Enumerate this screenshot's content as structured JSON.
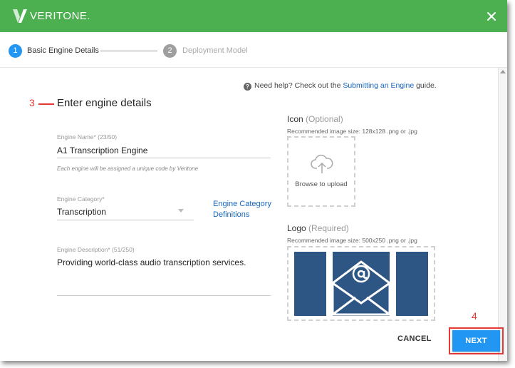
{
  "header": {
    "brand": "VERITONE",
    "brand_dot": ".",
    "close_icon": "close-icon",
    "logo_icon": "veritone-logo-icon",
    "color": "#4caf50"
  },
  "stepper": {
    "steps": [
      {
        "number": "1",
        "label": "Basic Engine Details",
        "active": true
      },
      {
        "number": "2",
        "label": "Deployment Model",
        "active": false
      }
    ],
    "active_color": "#2196f3"
  },
  "help": {
    "icon": "help-icon",
    "prefix": "Need help? Check out the ",
    "link": "Submitting an Engine",
    "suffix": " guide."
  },
  "annotations": {
    "three": "3",
    "four": "4",
    "color": "#e53935"
  },
  "form": {
    "title": "Enter engine details",
    "engine_name": {
      "label": "Engine Name* (23/50)",
      "value": "A1 Transcription Engine",
      "hint": "Each engine will be assigned a unique code by Veritone"
    },
    "engine_category": {
      "label": "Engine Category*",
      "value": "Transcription",
      "definitions_link": "Engine Category Definitions"
    },
    "engine_description": {
      "label": "Engine Description* (51/250)",
      "value": "Providing world-class audio transcription services."
    }
  },
  "icon_upload": {
    "title": "Icon",
    "qualifier": "(Optional)",
    "subtitle": "Recommended image size: 128x128 .png or .jpg",
    "button_text": "Browse to upload",
    "icon": "cloud-upload-icon"
  },
  "logo_upload": {
    "title": "Logo",
    "qualifier": "(Required)",
    "subtitle": "Recommended image size: 500x250 .png or .jpg",
    "image": "envelope-at-logo",
    "image_color": "#2d5684"
  },
  "footer": {
    "cancel": "CANCEL",
    "next": "NEXT"
  }
}
